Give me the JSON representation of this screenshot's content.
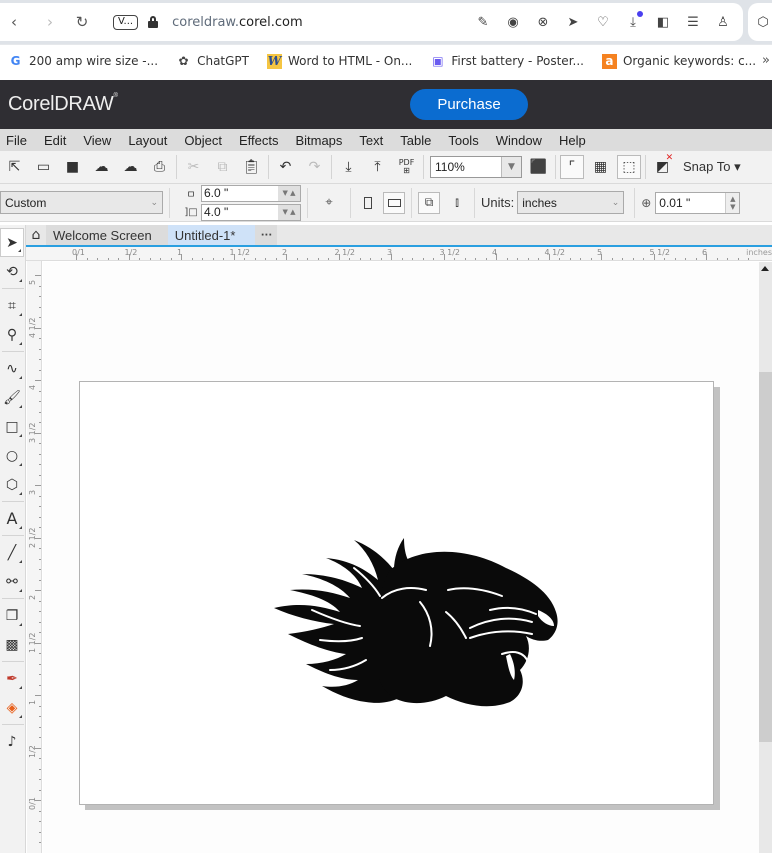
{
  "browser": {
    "site_badge": "V...",
    "url_sub": "coreldraw.",
    "url_domain": "corel.com",
    "bookmarks": [
      {
        "icon": "google-icon",
        "glyph": "G",
        "color": "#4285f4",
        "label": "200 amp wire size -..."
      },
      {
        "icon": "chatgpt-icon",
        "glyph": "✿",
        "color": "#444444",
        "label": "ChatGPT"
      },
      {
        "icon": "word-to-html-icon",
        "glyph": "W",
        "color": "#2f4f8f",
        "label": "Word to HTML - On..."
      },
      {
        "icon": "printer-icon",
        "glyph": "▣",
        "color": "#6a5cf0",
        "label": "First battery - Poster..."
      },
      {
        "icon": "ahrefs-icon",
        "glyph": "a",
        "color": "#f58220",
        "label": "Organic keywords: c..."
      }
    ],
    "more": "»"
  },
  "app": {
    "logo": "CorelDRAW",
    "purchase_label": "Purchase",
    "accent": "#0b6cd0"
  },
  "menu": [
    "File",
    "Edit",
    "View",
    "Layout",
    "Object",
    "Effects",
    "Bitmaps",
    "Text",
    "Table",
    "Tools",
    "Window",
    "Help"
  ],
  "toolbar": {
    "zoom_value": "110%",
    "pdf_label": "PDF",
    "snap_to_label": "Snap To ▾"
  },
  "property_bar": {
    "page_preset": "Custom",
    "width": "6.0 \"",
    "height": "4.0 \"",
    "units_label": "Units:",
    "units_value": "inches",
    "nudge_value": "0.01 \""
  },
  "tabs": {
    "welcome": "Welcome Screen",
    "document": "Untitled-1*",
    "more": "···"
  },
  "ruler": {
    "h_labels": [
      "0/1",
      "1/2",
      "1",
      "1 1/2",
      "2",
      "2 1/2",
      "3",
      "3 1/2",
      "4",
      "4 1/2",
      "5",
      "5 1/2",
      "6"
    ],
    "units": "inches",
    "v_labels": [
      "5",
      "4 1/2",
      "4",
      "3 1/2",
      "3",
      "2 1/2",
      "2",
      "1 1/2",
      "1",
      "1/2",
      "0/1"
    ]
  }
}
